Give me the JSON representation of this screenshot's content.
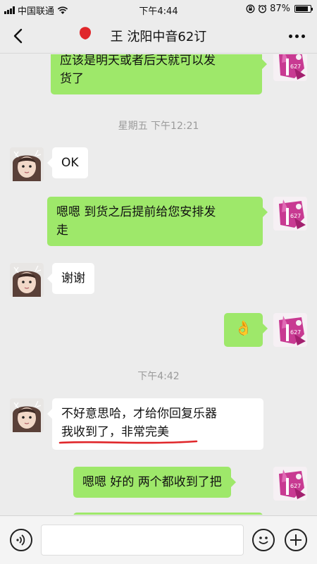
{
  "status_bar": {
    "carrier": "中国联通",
    "time": "下午4:44",
    "battery": "87%",
    "battery_level": 0.87
  },
  "header": {
    "title": "王 沈阳中音62订"
  },
  "messages": [
    {
      "type": "out",
      "text_line1": "应该是明天或者后天就可以发",
      "text_line2": "货了"
    },
    {
      "type": "timestamp",
      "text": "星期五 下午12:21"
    },
    {
      "type": "in",
      "text": "OK"
    },
    {
      "type": "out",
      "text_line1": "嗯嗯 到货之后提前给您安排发",
      "text_line2": "走"
    },
    {
      "type": "in",
      "text": "谢谢"
    },
    {
      "type": "out",
      "emoji": "👌"
    },
    {
      "type": "timestamp",
      "text": "下午4:42"
    },
    {
      "type": "in",
      "text_line1": "不好意思哈，才给你回复乐器",
      "text_line2": "我收到了，非常完美"
    },
    {
      "type": "out",
      "text": "嗯嗯 好的 两个都收到了把"
    }
  ],
  "input_bar": {
    "voice_icon": "voice-icon",
    "emoji_icon": "emoji-icon",
    "plus_icon": "plus-icon",
    "placeholder": ""
  },
  "colors": {
    "background": "#ececec",
    "outgoing_bubble": "#9ee86a",
    "incoming_bubble": "#ffffff",
    "annotation": "#e0262a"
  }
}
